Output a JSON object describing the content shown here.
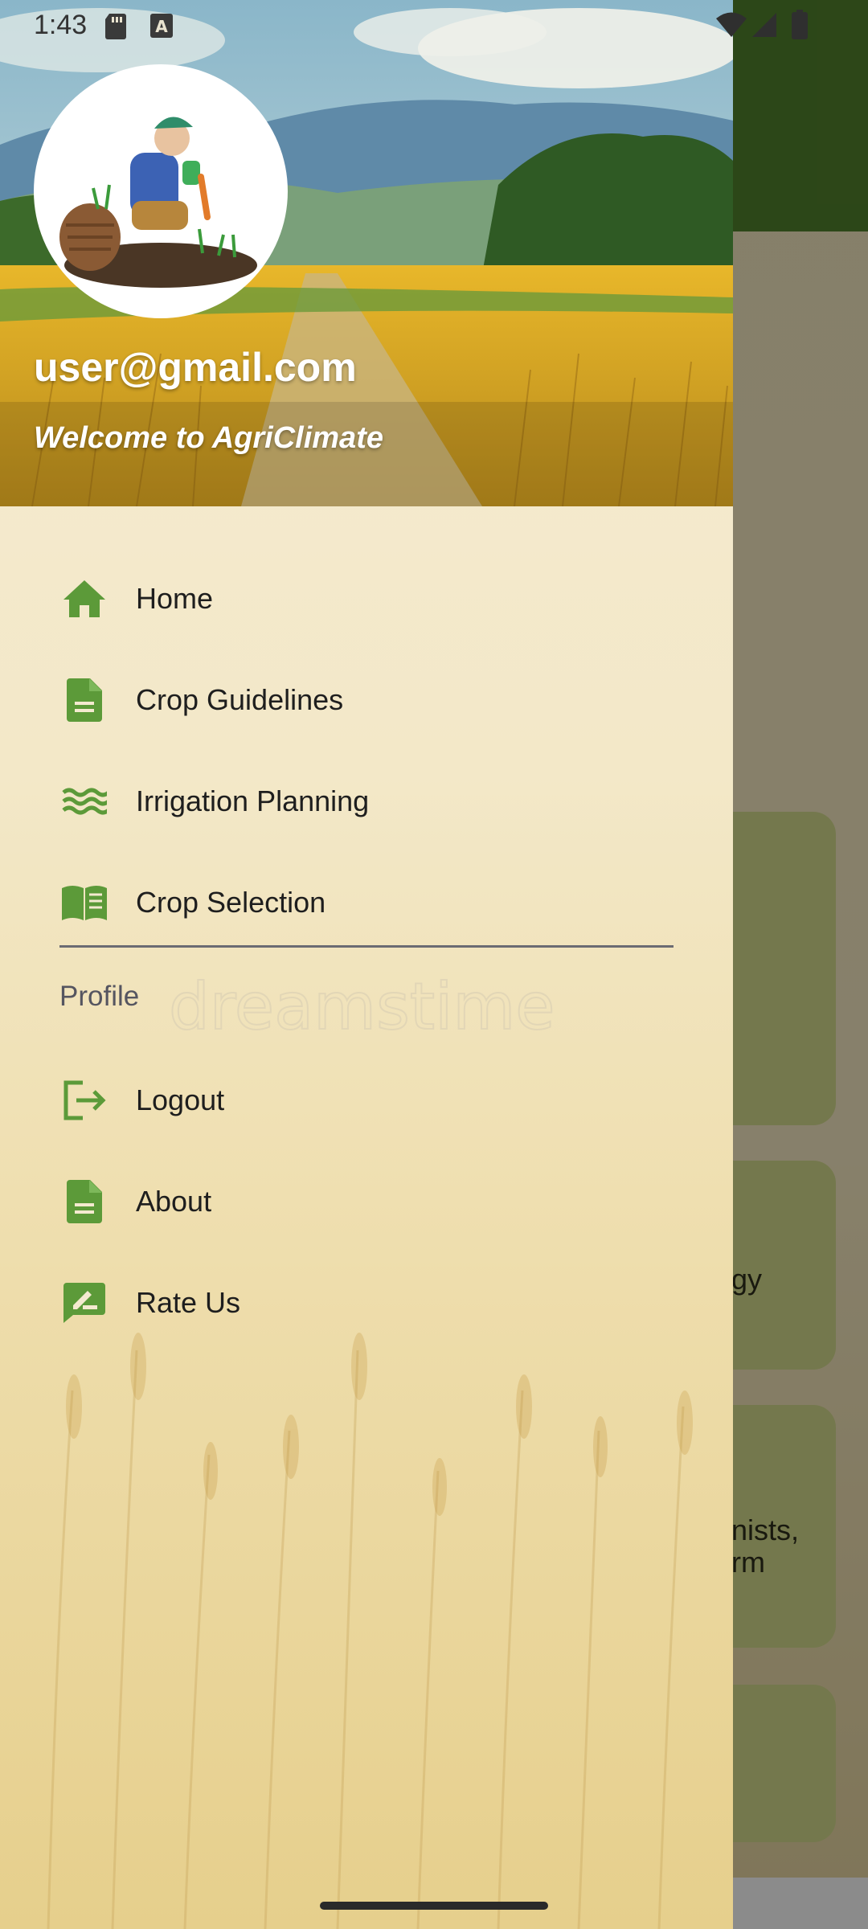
{
  "status_bar": {
    "time": "1:43",
    "icons": [
      "sd-card-icon",
      "keyboard-a-icon",
      "wifi-icon",
      "signal-icon",
      "battery-icon"
    ]
  },
  "drawer": {
    "header": {
      "email": "user@gmail.com",
      "welcome": "Welcome to AgriClimate",
      "avatar": "farmer-avatar"
    },
    "menu_items": [
      {
        "label": "Home",
        "icon": "home-icon"
      },
      {
        "label": "Crop Guidelines",
        "icon": "document-icon"
      },
      {
        "label": "Irrigation Planning",
        "icon": "waves-icon"
      },
      {
        "label": "Crop Selection",
        "icon": "book-icon"
      }
    ],
    "profile_section": {
      "title": "Profile",
      "items": [
        {
          "label": "Logout",
          "icon": "logout-icon"
        },
        {
          "label": "About",
          "icon": "document-icon"
        },
        {
          "label": "Rate Us",
          "icon": "rate-review-icon"
        }
      ]
    },
    "accent_color": "#5c9a39",
    "watermark": "dreamstime"
  },
  "background_app": {
    "card_fragments": [
      "gy",
      "nists,",
      "rm"
    ],
    "toolbar_color": "#4d7a2a",
    "card_color": "#c9cf85"
  }
}
